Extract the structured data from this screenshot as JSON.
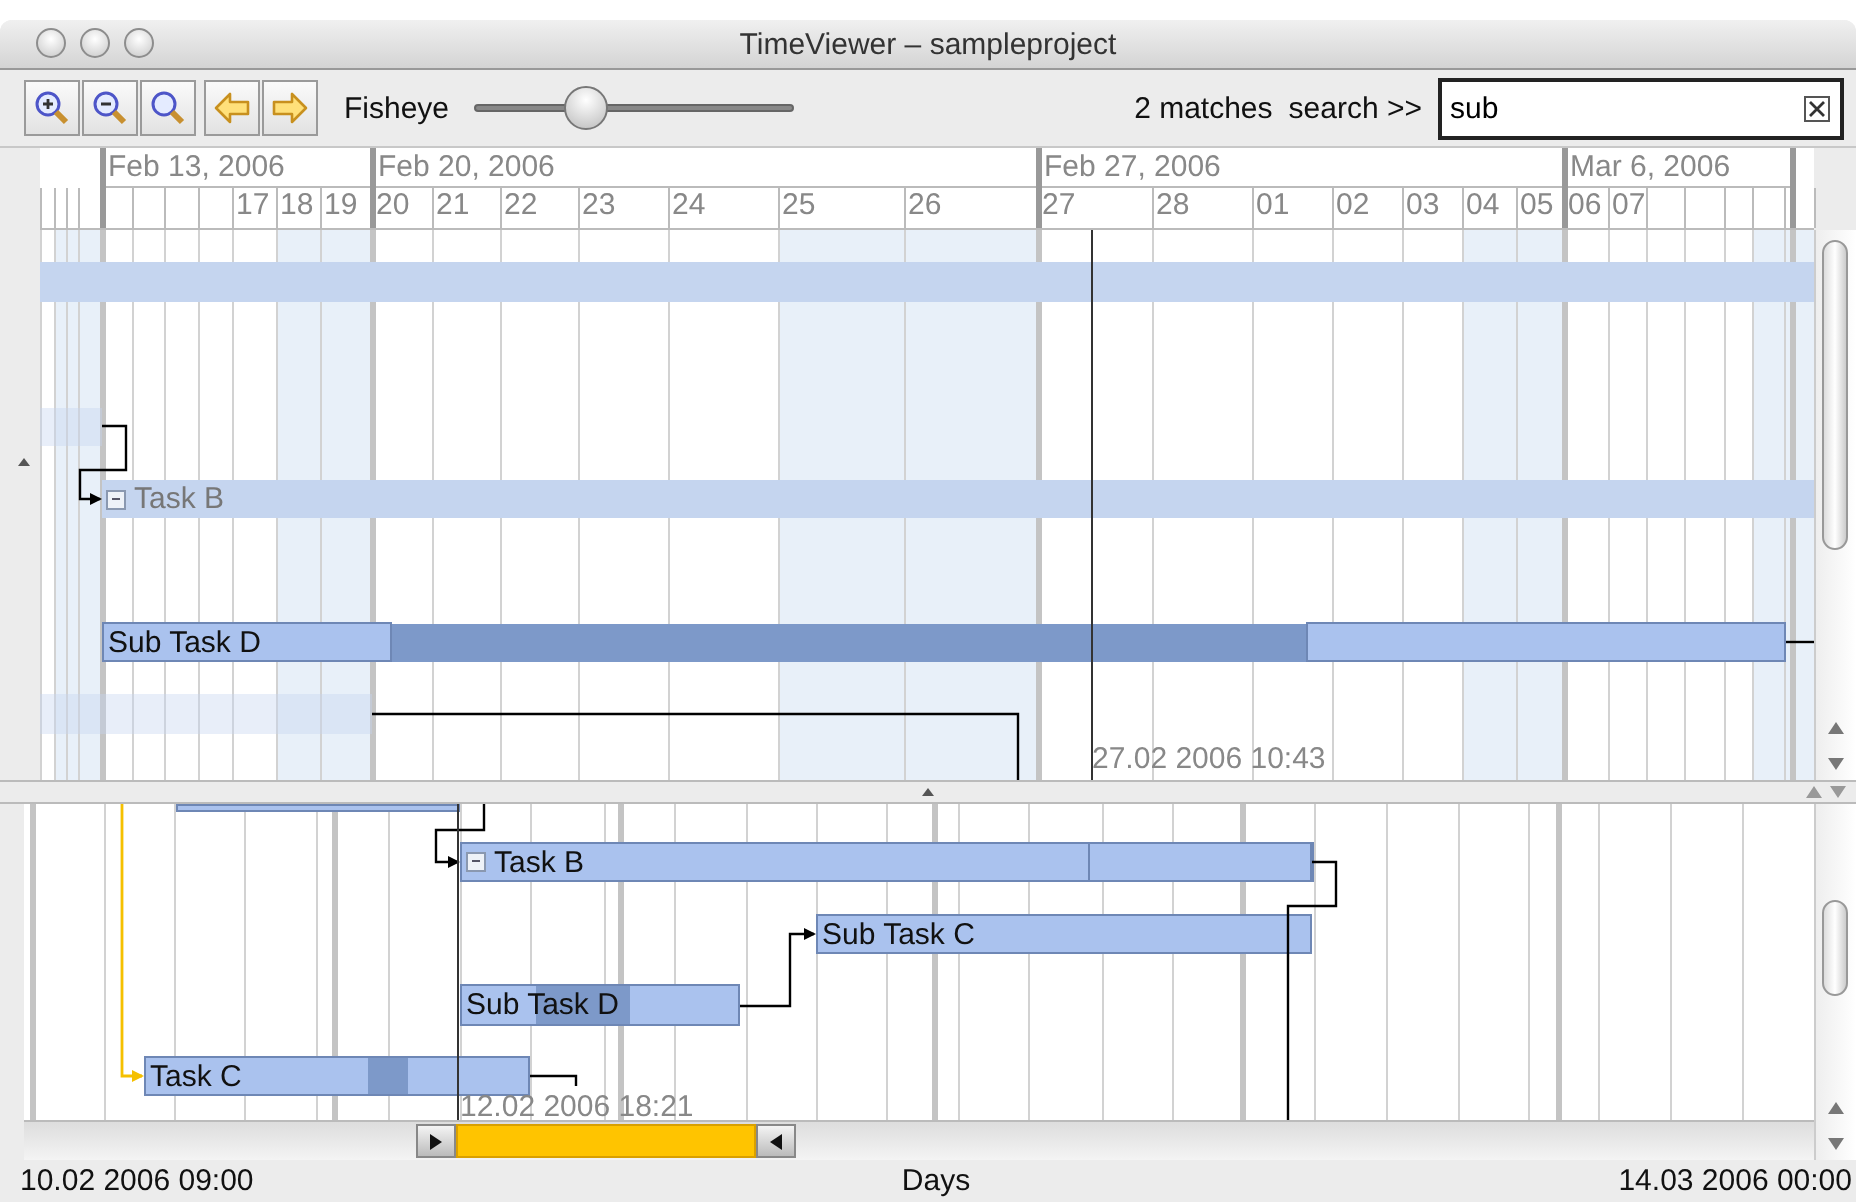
{
  "window": {
    "title": "TimeViewer – sampleproject"
  },
  "toolbar": {
    "fisheye": {
      "label": "Fisheye",
      "level": 0.35
    },
    "matches": "2 matches",
    "search_label": "search >>",
    "search": {
      "value": "sub"
    }
  },
  "timeline": {
    "weeks": [
      {
        "label": "Feb 13, 2006"
      },
      {
        "label": "Feb 20, 2006"
      },
      {
        "label": "Feb 27, 2006"
      },
      {
        "label": "Mar 6, 2006"
      }
    ],
    "days": [
      "17",
      "18",
      "19",
      "20",
      "21",
      "22",
      "23",
      "24",
      "25",
      "26",
      "27",
      "28",
      "01",
      "02",
      "03",
      "04",
      "05",
      "06",
      "07"
    ]
  },
  "overview": {
    "tasks": [
      {
        "label": "Task B",
        "kind": "group",
        "expanded": true,
        "faded": true
      },
      {
        "label": "Sub Task D",
        "kind": "task",
        "faded": false
      }
    ],
    "cursor_time": "27.02 2006 10:43"
  },
  "detail": {
    "tasks": [
      {
        "label": "Task B",
        "kind": "group",
        "expanded": true
      },
      {
        "label": "Sub Task C",
        "kind": "task"
      },
      {
        "label": "Sub Task D",
        "kind": "task"
      },
      {
        "label": "Task C",
        "kind": "task"
      }
    ],
    "cursor_time": "12.02 2006 18:21"
  },
  "status_bar": {
    "start": "10.02 2006 09:00",
    "unit": "Days",
    "end": "14.03 2006 00:00"
  }
}
